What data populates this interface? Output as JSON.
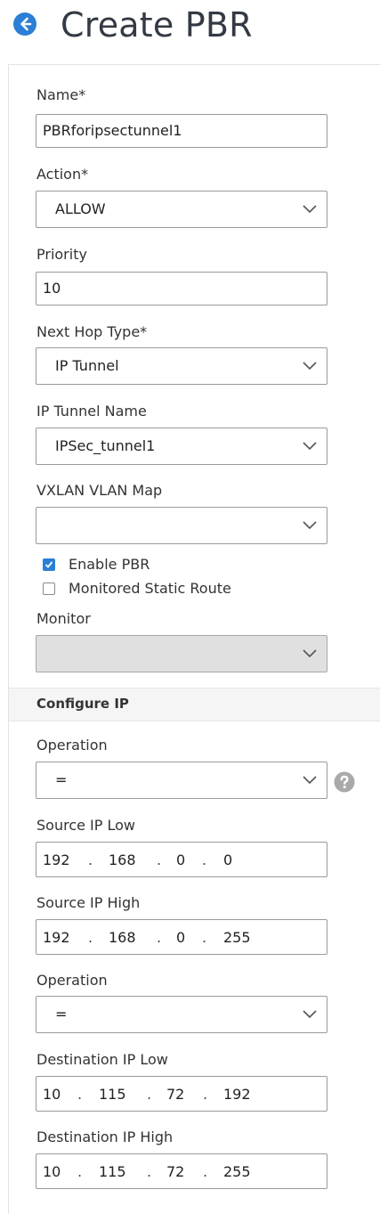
{
  "header": {
    "title": "Create PBR",
    "back_icon": "arrow-left-circle-icon",
    "accent": "#2c7fd6"
  },
  "form": {
    "name": {
      "label": "Name*",
      "value": "PBRforipsectunnel1"
    },
    "action": {
      "label": "Action*",
      "value": "ALLOW"
    },
    "priority": {
      "label": "Priority",
      "value": "10"
    },
    "next_hop_type": {
      "label": "Next Hop Type*",
      "value": "IP Tunnel"
    },
    "ip_tunnel_name": {
      "label": "IP Tunnel Name",
      "value": "IPSec_tunnel1"
    },
    "vxlan_vlan_map": {
      "label": "VXLAN VLAN Map",
      "value": ""
    },
    "enable_pbr": {
      "label": "Enable PBR",
      "checked": true
    },
    "monitored_static_route": {
      "label": "Monitored Static Route",
      "checked": false
    },
    "monitor": {
      "label": "Monitor",
      "value": "",
      "disabled": true
    }
  },
  "configure_ip": {
    "title": "Configure IP",
    "operation": {
      "label": "Operation",
      "value": "="
    },
    "source_ip_low": {
      "label": "Source IP Low",
      "octets": [
        "192",
        "168",
        "0",
        "0"
      ]
    },
    "source_ip_high": {
      "label": "Source IP High",
      "octets": [
        "192",
        "168",
        "0",
        "255"
      ]
    },
    "dest_operation": {
      "label": "Operation",
      "value": "="
    },
    "destination_ip_low": {
      "label": "Destination IP Low",
      "octets": [
        "10",
        "115",
        "72",
        "192"
      ]
    },
    "destination_ip_high": {
      "label": "Destination IP High",
      "octets": [
        "10",
        "115",
        "72",
        "255"
      ]
    }
  },
  "ip_separator": "."
}
